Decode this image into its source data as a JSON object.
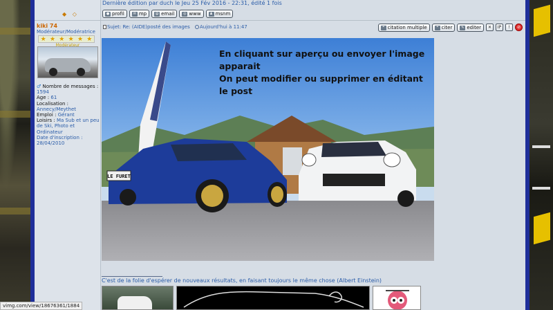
{
  "edit_note": "Dernière édition par duch le Jeu 25 Fév 2016 - 22:31, édité 1 fois",
  "nav_arrows": "◆ ◇",
  "post_buttons": [
    {
      "label": "profil",
      "icon": "profile-icon"
    },
    {
      "label": "mp",
      "icon": "private-message-icon"
    },
    {
      "label": "email",
      "icon": "email-icon"
    },
    {
      "label": "www",
      "icon": "website-icon"
    },
    {
      "label": "msnm",
      "icon": "msn-icon"
    }
  ],
  "profile": {
    "username": "kiki 74",
    "rank": "Modérateur/Modératrice",
    "rank_label": "Modérateur",
    "stars": "★★★★★★",
    "gender_icon": "male-icon",
    "messages_label": "Nombre de messages :",
    "messages_value": "1594",
    "age_label": "Age :",
    "age_value": "61",
    "location_label": "Localisation :",
    "location_value": "Annecy/Meythet",
    "job_label": "Emploi :",
    "job_value": "Gérant",
    "hobbies_label": "Loisirs :",
    "hobbies_value": "Ma Sub et un peu de Ski, Photo et Ordinateur",
    "signup_label": "Date d'inscription :",
    "signup_value": "28/04/2010"
  },
  "post": {
    "subject": "Sujet: Re: (AIDE)posté des images",
    "time": "Aujourd'hui à 11:47",
    "actions": {
      "quote_multi": "citation multiple",
      "quote": "citer",
      "edit": "editer",
      "delete": "✕",
      "ip": "IP",
      "warn": "!",
      "report": "⊘"
    },
    "caption_lines": [
      "En cliquant sur aperçu ou envoyer l'image apparait",
      "On peut modifier ou supprimer en éditant le post"
    ],
    "plate_text": "LE FURET",
    "signature": "C'est de la folie d'espérer de nouveaux résultats, en faisant toujours le même chose (Albert Einstein)"
  },
  "status_bar": "vimg.com/view/18676361/1884"
}
